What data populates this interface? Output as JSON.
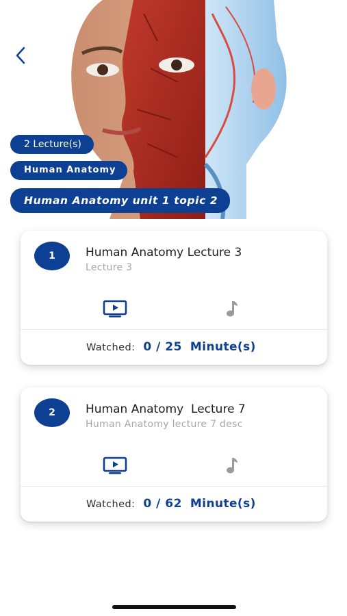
{
  "header": {
    "back_icon": "chevron-left-icon",
    "hero_image": "anatomy-face-muscle-illustration",
    "lecture_count": "2 Lecture(s)",
    "subject": "Human Anatomy",
    "topic": "Human Anatomy unit 1 topic 2"
  },
  "colors": {
    "brand": "#0d3f93",
    "muted_text": "#a7a7a7",
    "audio_icon": "#9b9b9b"
  },
  "lectures": [
    {
      "number": "1",
      "title": "Human Anatomy Lecture 3",
      "description": "Lecture 3",
      "video_icon": "video-player-icon",
      "audio_icon": "music-note-icon",
      "watched_label": "Watched:",
      "watched_value": "0 / 25",
      "watched_unit": "Minute(s)"
    },
    {
      "number": "2",
      "title": "Human Anatomy  Lecture 7",
      "description": "Human Anatomy lecture 7 desc",
      "video_icon": "video-player-icon",
      "audio_icon": "music-note-icon",
      "watched_label": "Watched:",
      "watched_value": "0 / 62",
      "watched_unit": "Minute(s)"
    }
  ]
}
